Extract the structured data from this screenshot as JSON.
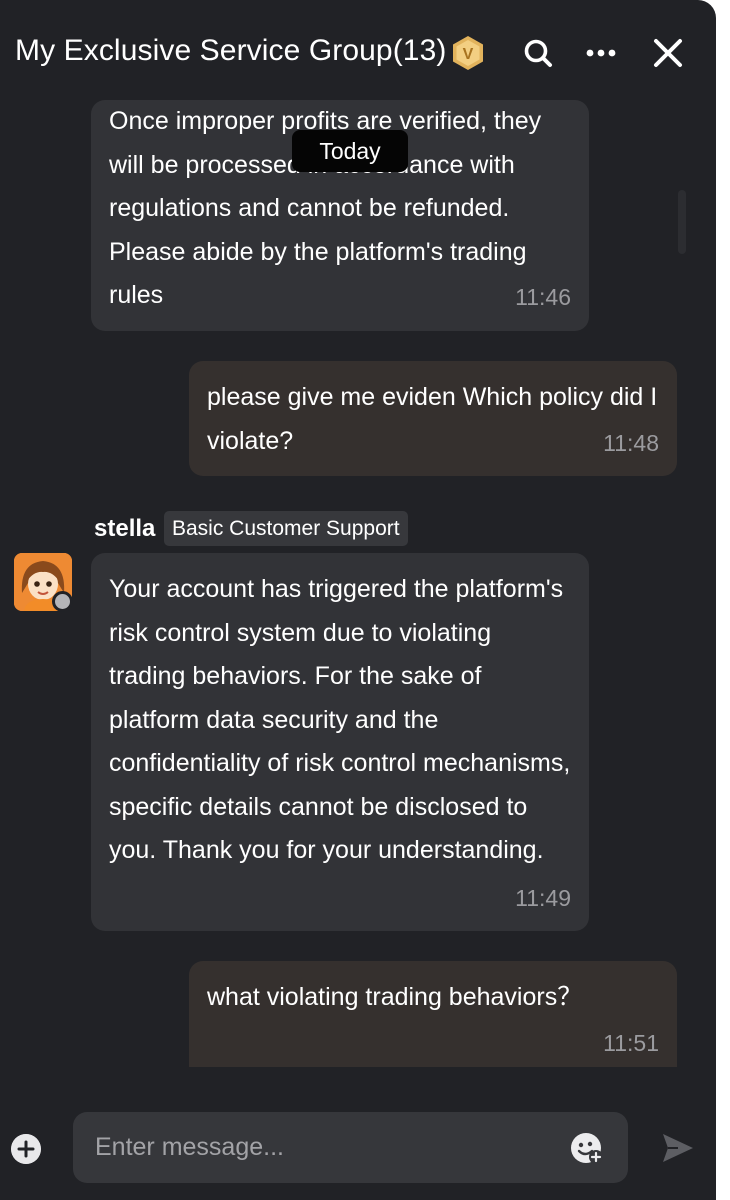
{
  "header": {
    "title": "My Exclusive Service Group(13)",
    "vip_badge_letter": "V",
    "icons": [
      "search-icon",
      "more-icon",
      "close-icon"
    ]
  },
  "date_divider": "Today",
  "messages": [
    {
      "direction": "in",
      "text": "Once improper profits are verified, they will be processed in accordance with regulations and cannot be refunded. Please abide by the platform's trading rules",
      "time": "11:46"
    },
    {
      "direction": "out",
      "text": "please give me eviden Which policy did I violate?",
      "time": "11:48"
    },
    {
      "direction": "in",
      "sender": "stella",
      "sender_role": "Basic Customer Support",
      "text": "Your account has triggered the platform's risk control system due to violating trading behaviors. For the sake of platform data security and the confidentiality of risk control mechanisms, specific details cannot be disclosed to you. Thank you for your understanding.",
      "time": "11:49"
    },
    {
      "direction": "out",
      "text": "what violating trading behaviors？",
      "time": "11:51"
    }
  ],
  "composer": {
    "placeholder": "Enter message...",
    "value": ""
  },
  "colors": {
    "background": "#212226",
    "incoming_bubble": "#323337",
    "outgoing_bubble": "#35302e",
    "badge_gold": "#e0b15a"
  }
}
